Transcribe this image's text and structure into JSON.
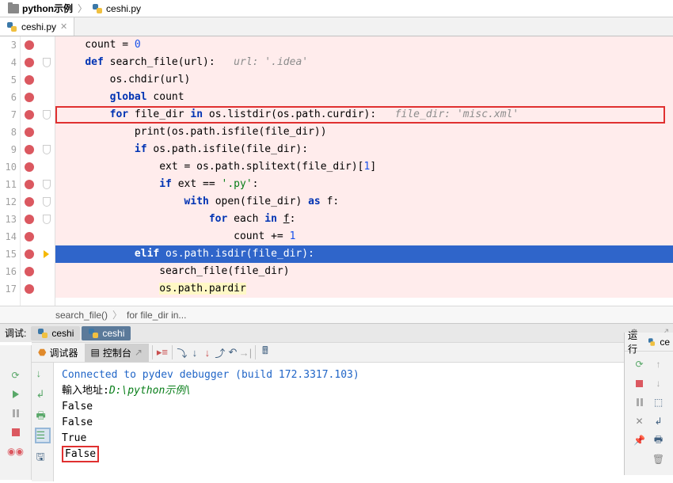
{
  "breadcrumb": {
    "folder": "python示例",
    "file": "ceshi.py"
  },
  "tab": {
    "name": "ceshi.py"
  },
  "lines": {
    "3": {
      "num": "3",
      "bp": true,
      "code": "    count = 0"
    },
    "4": {
      "num": "4",
      "bp": true,
      "code": "    def search_file(url):   url: '.idea'"
    },
    "5": {
      "num": "5",
      "bp": true,
      "code": "        os.chdir(url)"
    },
    "6": {
      "num": "6",
      "bp": true,
      "code": "        global count"
    },
    "7": {
      "num": "7",
      "bp": true,
      "code": "        for file_dir in os.listdir(os.path.curdir):   file_dir: 'misc.xml'"
    },
    "8": {
      "num": "8",
      "bp": true,
      "code": "            print(os.path.isfile(file_dir))"
    },
    "9": {
      "num": "9",
      "bp": true,
      "code": "            if os.path.isfile(file_dir):"
    },
    "10": {
      "num": "10",
      "bp": true,
      "code": "                ext = os.path.splitext(file_dir)[1]"
    },
    "11": {
      "num": "11",
      "bp": true,
      "code": "                if ext == '.py':"
    },
    "12": {
      "num": "12",
      "bp": true,
      "code": "                    with open(file_dir) as f:"
    },
    "13": {
      "num": "13",
      "bp": true,
      "code": "                        for each in f:"
    },
    "14": {
      "num": "14",
      "bp": true,
      "code": "                            count += 1"
    },
    "15": {
      "num": "15",
      "bp": true,
      "code": "            elif os.path.isdir(file_dir):"
    },
    "16": {
      "num": "16",
      "bp": true,
      "code": "                search_file(file_dir)"
    },
    "17": {
      "num": "17",
      "bp": true,
      "code": "                os.path.pardir"
    }
  },
  "crumb2": {
    "fn": "search_file()",
    "loop": "for file_dir in..."
  },
  "debug": {
    "label": "调试:",
    "tab1": "ceshi",
    "tab2": "ceshi",
    "debugger_tab": "调试器",
    "console_tab": "控制台"
  },
  "console": {
    "line1": "Connected to pydev debugger (build 172.3317.103)",
    "line2_prefix": "輸入地址:",
    "line2_value": "D:\\python示例\\",
    "line3": "False",
    "line4": "False",
    "line5": "True",
    "line6": "False"
  },
  "right": {
    "label": "运行",
    "file_short": "ce"
  }
}
